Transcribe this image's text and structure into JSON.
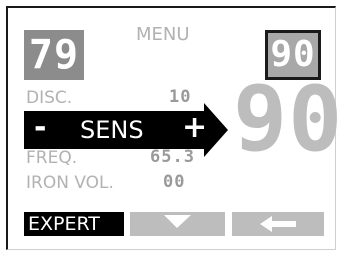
{
  "menu": {
    "title": "MENU"
  },
  "left_display": {
    "value": "79"
  },
  "right_display": {
    "value": "90"
  },
  "main_display": {
    "value": "90"
  },
  "settings": [
    {
      "label": "DISC.",
      "value": "10"
    },
    {
      "label": "SENS",
      "minus": "-",
      "plus": "+"
    },
    {
      "label": "FREQ.",
      "value": "65.3"
    },
    {
      "label": "IRON VOL.",
      "value": "00"
    }
  ],
  "softkeys": {
    "expert": "EXPERT",
    "down_icon": "chevron-down-icon",
    "back_icon": "back-arrow-icon"
  },
  "colors": {
    "highlight": "#000000",
    "text_dim": "#b2b2b2",
    "accent_gray": "#8c8c8c"
  }
}
